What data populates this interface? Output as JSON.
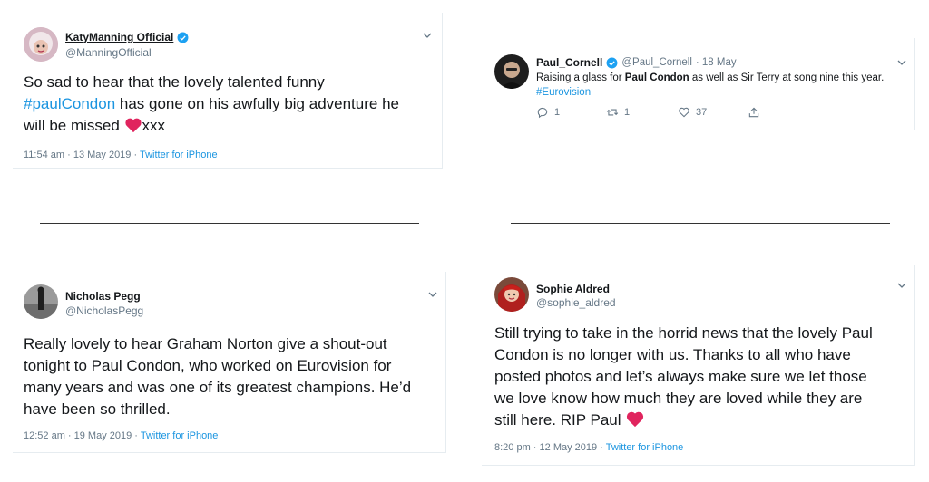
{
  "tweets": {
    "katy": {
      "name": "KatyManning Official",
      "handle": "@ManningOfficial",
      "text_1": "So sad to hear that  the lovely talented funny",
      "hashtag": "#paulCondon",
      "text_2": " has gone on his awfully big adventure he",
      "text_3": "will be missed ",
      "text_4": "xxx",
      "time": "11:54 am · 13 May 2019",
      "sep": " · ",
      "source": "Twitter for iPhone"
    },
    "paul": {
      "name": "Paul_Cornell",
      "handle": "@Paul_Cornell",
      "date": "· 18 May",
      "text_1": "Raising a glass for ",
      "bold": "Paul Condon",
      "text_2": " as well as Sir Terry at song nine this year.",
      "hashtag": "#Eurovision",
      "replies": "1",
      "retweets": "1",
      "likes": "37"
    },
    "nicholas": {
      "name": "Nicholas Pegg",
      "handle": "@NicholasPegg",
      "line_1": "Really lovely to hear Graham Norton give a shout-out",
      "line_2": "tonight to Paul Condon, who worked on Eurovision for",
      "line_3": "many years and was one of its greatest champions. He’d",
      "line_4": "have been so thrilled.",
      "time": "12:52 am · 19 May 2019",
      "sep": " · ",
      "source": "Twitter for iPhone"
    },
    "sophie": {
      "name": "Sophie Aldred",
      "handle": "@sophie_aldred",
      "line_1": "Still trying to take in the horrid news that the lovely Paul",
      "line_2": "Condon is no longer with us. Thanks to all who have",
      "line_3": "posted photos and let’s always make sure we let those",
      "line_4": "we love know how much they are loved while they are",
      "line_5": "still here. RIP Paul ",
      "time": "8:20 pm · 12 May 2019",
      "sep": " · ",
      "source": "Twitter for iPhone"
    }
  },
  "colors": {
    "link": "#1b95e0",
    "muted": "#657786",
    "heart": "#e0245e",
    "verified": "#1da1f2"
  }
}
